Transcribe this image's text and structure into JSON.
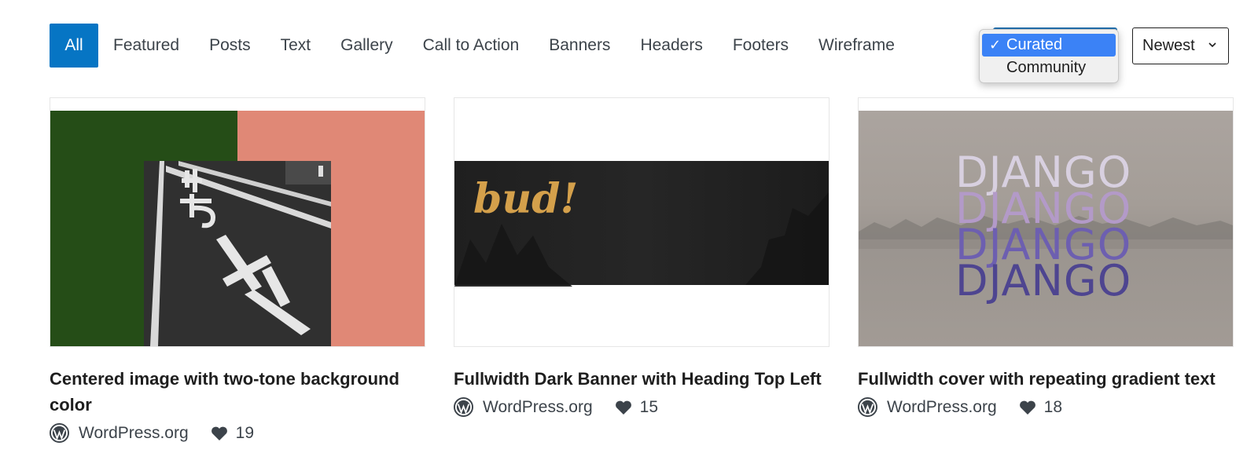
{
  "nav": {
    "items": [
      "All",
      "Featured",
      "Posts",
      "Text",
      "Gallery",
      "Call to Action",
      "Banners",
      "Headers",
      "Footers",
      "Wireframe"
    ],
    "active": "All"
  },
  "source_dropdown": {
    "options": [
      "Curated",
      "Community"
    ],
    "selected": "Curated",
    "check": "✓"
  },
  "sort": {
    "label": "Newest"
  },
  "cards": [
    {
      "title": "Centered image with two-tone background color",
      "author": "WordPress.org",
      "likes": "19"
    },
    {
      "title": "Fullwidth Dark Banner with Heading Top Left",
      "author": "WordPress.org",
      "likes": "15",
      "preview_text": "bud!"
    },
    {
      "title": "Fullwidth cover with repeating gradient text",
      "author": "WordPress.org",
      "likes": "18",
      "preview_words": [
        "DJANGO",
        "DJANGO",
        "DJANGO",
        "DJANGO"
      ]
    }
  ],
  "colors": {
    "active_nav": "#0675c4",
    "dropdown_highlight": "#3b82f6",
    "two_tone_green": "#254d17",
    "two_tone_salmon": "#e08876",
    "banner_gold": "#d4a04b",
    "django_colors": [
      "#d8d0e0",
      "#b39ac8",
      "#6d5fb0",
      "#4e4590"
    ]
  },
  "icons": {
    "author": "wordpress-logo-icon",
    "likes": "heart-icon",
    "sort": "chevron-down-icon"
  }
}
